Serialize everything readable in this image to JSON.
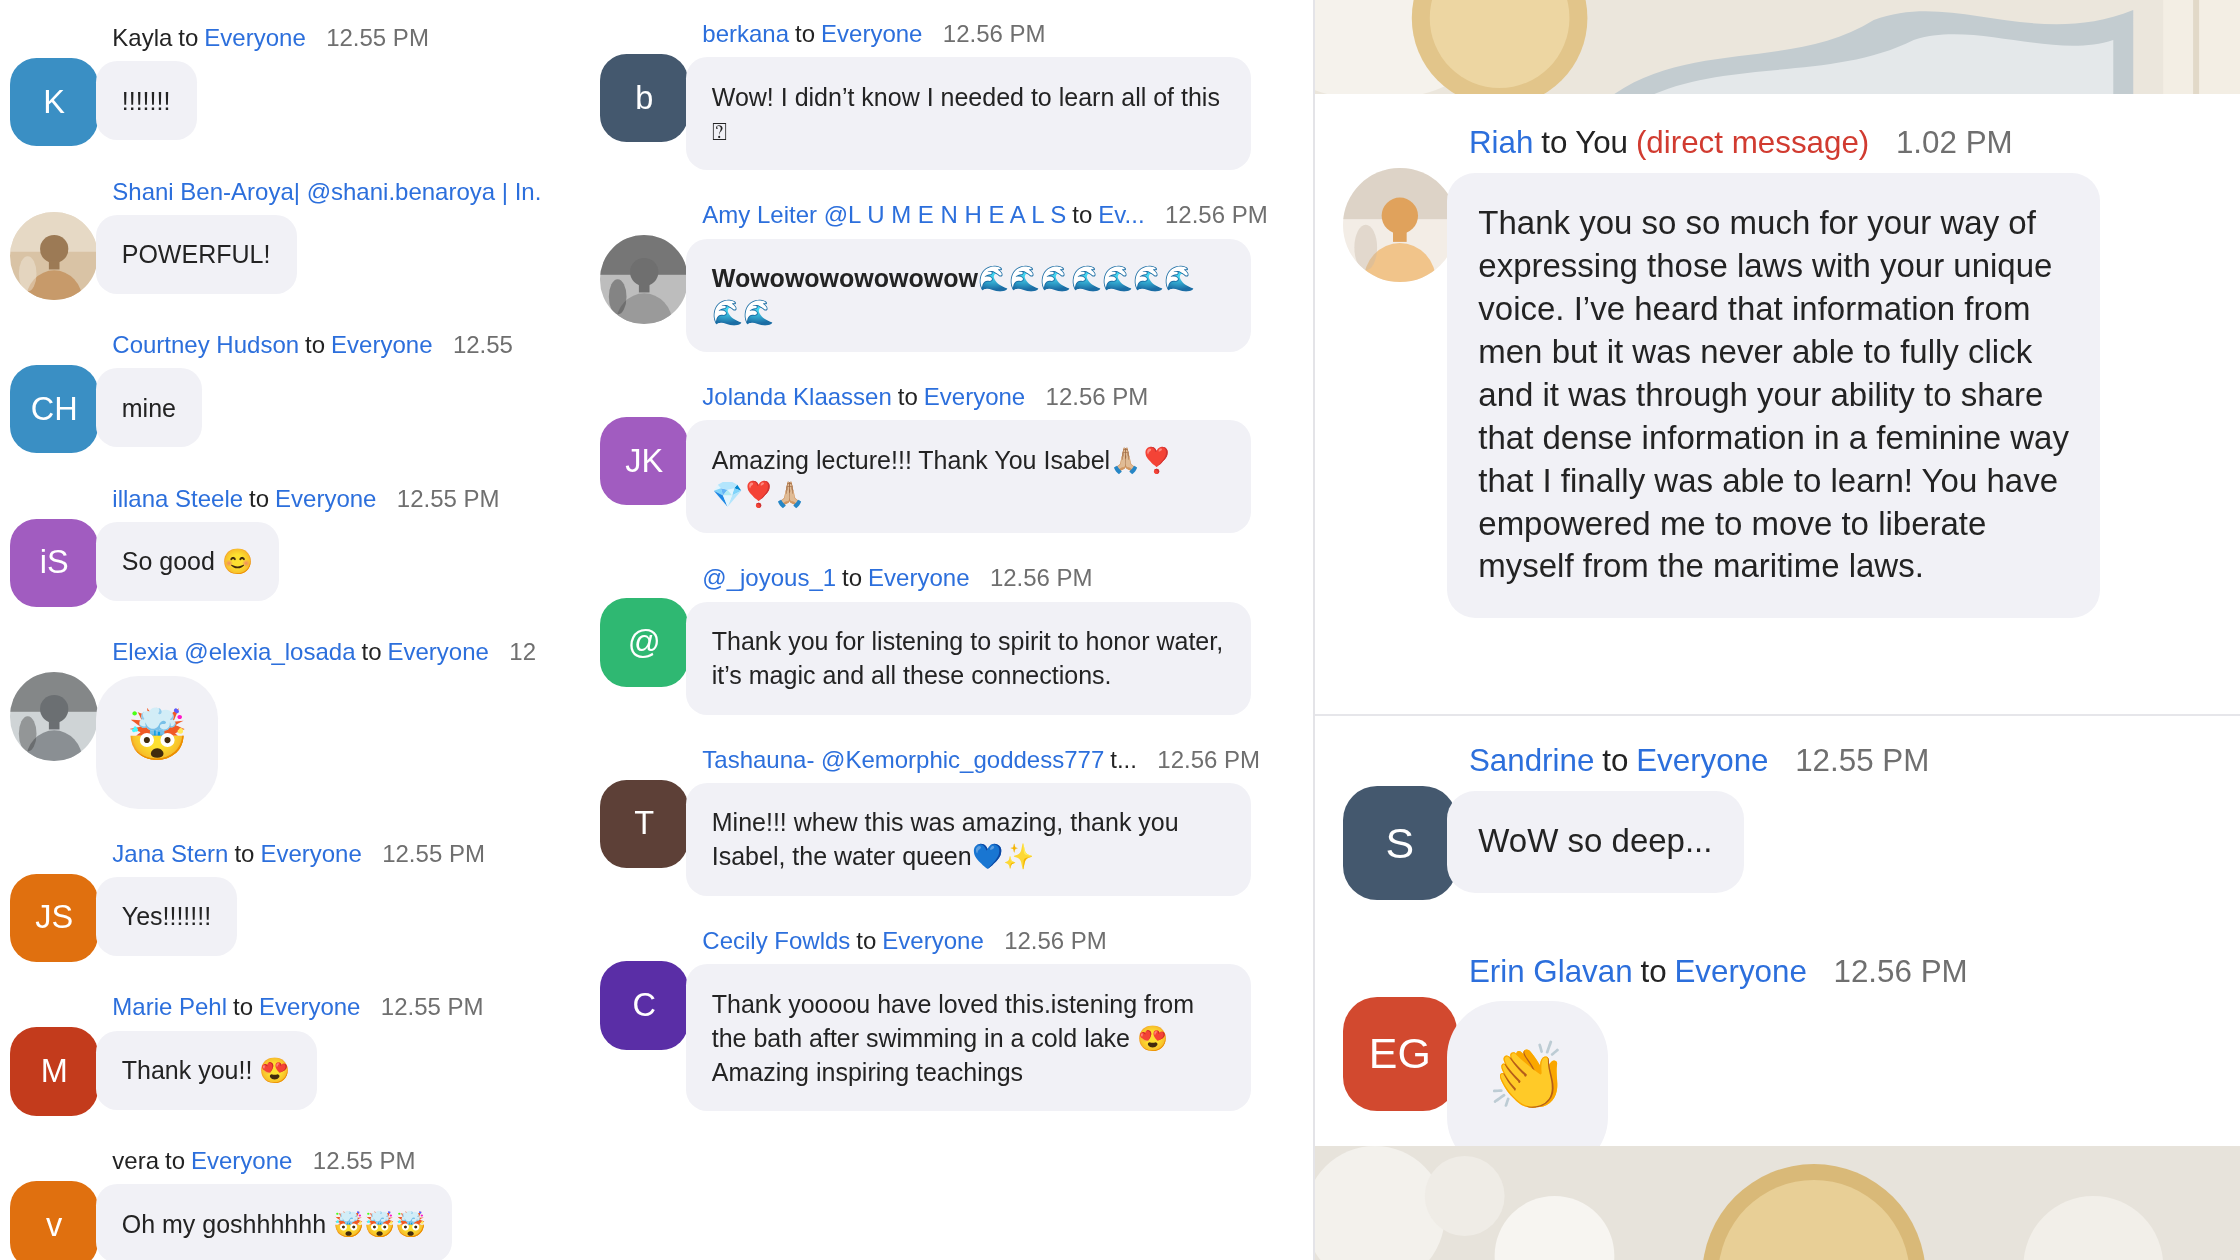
{
  "columns": [
    {
      "kind": "chat",
      "messages": [
        {
          "sender": "Kayla",
          "sender_link": false,
          "connector": "to",
          "recipient": "Everyone",
          "time": "12.55 PM",
          "text": "!!!!!!!",
          "avatar": {
            "kind": "initials",
            "initials": "K",
            "color": "#3a8fc4"
          }
        },
        {
          "sender": "Shani Ben-Aroya| @shani.benaroya | In.",
          "sender_link": true,
          "text": "POWERFUL!",
          "avatar": {
            "kind": "picture"
          }
        },
        {
          "sender": "Courtney Hudson",
          "sender_link": true,
          "connector": "to",
          "recipient": "Everyone",
          "time": "12.55",
          "text": "mine",
          "avatar": {
            "kind": "initials",
            "initials": "CH",
            "color": "#3a8fc4"
          }
        },
        {
          "sender": "illana Steele",
          "sender_link": true,
          "connector": "to",
          "recipient": "Everyone",
          "time": "12.55 PM",
          "text": "So good 😊",
          "avatar": {
            "kind": "initials",
            "initials": "iS",
            "color": "#a15cc0"
          }
        },
        {
          "sender": "Elexia @elexia_losada",
          "sender_link": true,
          "connector": "to",
          "recipient": "Everyone",
          "time": "12",
          "text": "🤯",
          "jumbo": true,
          "avatar": {
            "kind": "picture"
          }
        },
        {
          "sender": "Jana Stern",
          "sender_link": true,
          "connector": "to",
          "recipient": "Everyone",
          "time": "12.55 PM",
          "text": "Yes!!!!!!!",
          "avatar": {
            "kind": "initials",
            "initials": "JS",
            "color": "#e0700f"
          }
        },
        {
          "sender": "Marie Pehl",
          "sender_link": true,
          "connector": "to",
          "recipient": "Everyone",
          "time": "12.55 PM",
          "text": "Thank you!! 😍",
          "avatar": {
            "kind": "initials",
            "initials": "M",
            "color": "#c33b1c"
          }
        },
        {
          "sender": "vera",
          "sender_link": false,
          "connector": "to",
          "recipient": "Everyone",
          "time": "12.55 PM",
          "text": "Oh my goshhhhhh 🤯🤯🤯",
          "avatar": {
            "kind": "initials",
            "initials": "v",
            "color": "#e0700f"
          }
        }
      ]
    },
    {
      "kind": "chat",
      "messages": [
        {
          "sender": "berkana",
          "sender_link": true,
          "connector": "to",
          "recipient": "Everyone",
          "time": "12.56 PM",
          "text": "Wow! I didn’t know I needed to learn all of this ⍰",
          "avatar": {
            "kind": "initials",
            "initials": "b",
            "color": "#44586e"
          }
        },
        {
          "sender": "Amy Leiter @L U M E N H E A L S",
          "sender_link": true,
          "connector": "to",
          "recipient": "Ev...",
          "time": "12.56 PM",
          "text": "Wowowowowowowow🌊🌊🌊🌊🌊🌊🌊🌊🌊",
          "bold": true,
          "avatar": {
            "kind": "picture"
          }
        },
        {
          "sender": "Jolanda Klaassen",
          "sender_link": true,
          "connector": "to",
          "recipient": "Everyone",
          "time": "12.56 PM",
          "text": "Amazing lecture!!! Thank You Isabel🙏🏼❣️💎❣️🙏🏼",
          "avatar": {
            "kind": "initials",
            "initials": "JK",
            "color": "#a15cc0"
          }
        },
        {
          "sender": "@_joyous_1",
          "sender_link": true,
          "connector": "to",
          "recipient": "Everyone",
          "time": "12.56 PM",
          "text": "Thank you for listening to spirit to honor water, it’s magic and all these connections.",
          "avatar": {
            "kind": "initials",
            "initials": "@",
            "color": "#2fb872"
          }
        },
        {
          "sender": "Tashauna- @Kemorphic_goddess777",
          "sender_link": true,
          "connector": "t...",
          "time": "12.56 PM",
          "text": "Mine!!! whew this was amazing, thank you Isabel, the water queen💙✨",
          "avatar": {
            "kind": "initials",
            "initials": "T",
            "color": "#5d4037"
          }
        },
        {
          "sender": "Cecily Fowlds",
          "sender_link": true,
          "connector": "to",
          "recipient": "Everyone",
          "time": "12.56 PM",
          "text": "Thank yoooou have loved this.istening from the bath after swimming in a cold lake 😍 Amazing inspiring teachings",
          "avatar": {
            "kind": "initials",
            "initials": "C",
            "color": "#5a2ea6"
          }
        }
      ]
    },
    {
      "kind": "stack",
      "parts": [
        {
          "kind": "picture"
        },
        {
          "kind": "chat",
          "messages": [
            {
              "sender": "Riah",
              "sender_link": true,
              "connector": "to",
              "recipient": "You",
              "recipient_link": false,
              "note": "(direct message)",
              "time": "1.02 PM",
              "text": "Thank you so so much for your way of expressing those laws with your unique voice. I’ve heard that information from men but it was never able to fully click and it was through your ability to share that dense information in a feminine way that I finally was able to learn! You have empowered me to move to liberate myself from the maritime laws.",
              "avatar": {
                "kind": "picture"
              }
            }
          ]
        },
        {
          "kind": "chat",
          "messages": [
            {
              "sender": "Sandrine",
              "sender_link": true,
              "connector": "to",
              "recipient": "Everyone",
              "time": "12.55 PM",
              "text": "WoW so deep...",
              "avatar": {
                "kind": "initials",
                "initials": "S",
                "color": "#44586e"
              }
            },
            {
              "sender": "Erin Glavan",
              "sender_link": true,
              "connector": "to",
              "recipient": "Everyone",
              "time": "12.56 PM",
              "text": "👏",
              "jumbo": true,
              "avatar": {
                "kind": "initials",
                "initials": "EG",
                "color": "#d2492f"
              }
            }
          ]
        },
        {
          "kind": "picture"
        }
      ]
    }
  ]
}
